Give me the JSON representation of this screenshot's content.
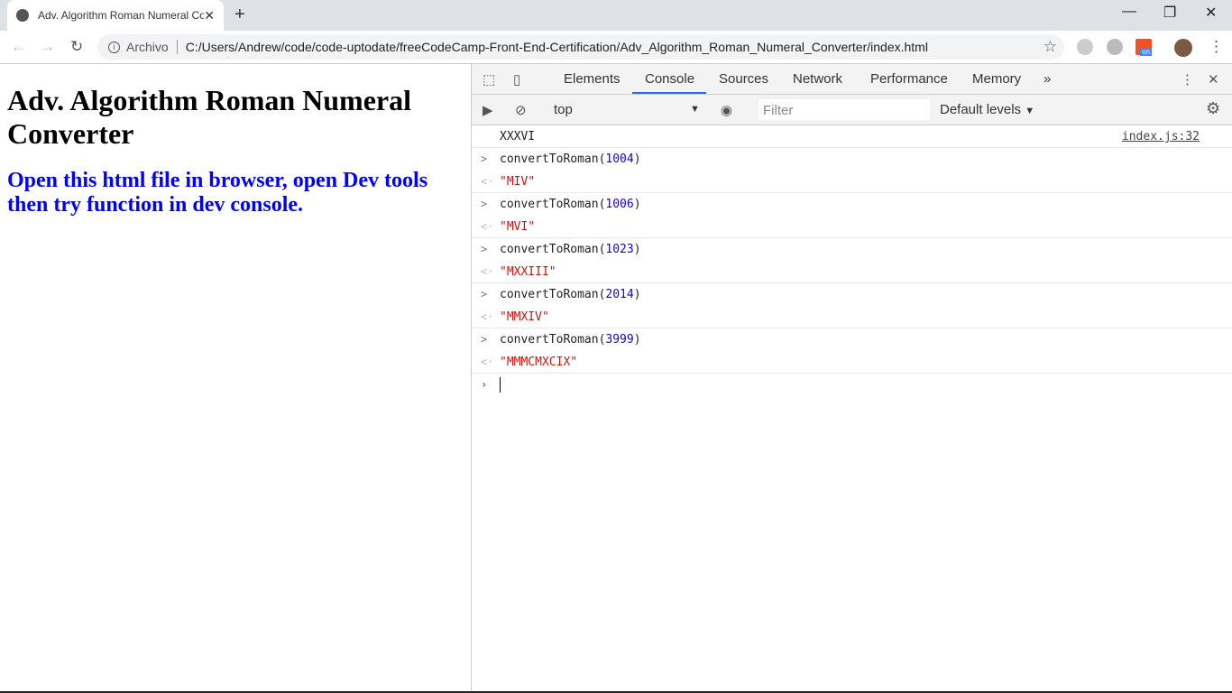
{
  "browser": {
    "tab_title": "Adv. Algorithm Roman Numeral Converter",
    "scheme_label": "Archivo",
    "url": "C:/Users/Andrew/code/code-uptodate/freeCodeCamp-Front-End-Certification/Adv_Algorithm_Roman_Numeral_Converter/index.html",
    "ext_badge": "on"
  },
  "page": {
    "title": "Adv. Algorithm Roman Numeral Converter",
    "subtitle": "Open this html file in browser, open Dev tools then try function in dev console."
  },
  "devtools": {
    "tabs": [
      "Elements",
      "Console",
      "Sources",
      "Network",
      "Performance",
      "Memory"
    ],
    "active_tab": "Console",
    "context": "top",
    "filter_placeholder": "Filter",
    "levels": "Default levels"
  },
  "console": {
    "log": {
      "text": "XXXVI",
      "source": "index.js:32"
    },
    "entries": [
      {
        "fn": "convertToRoman(",
        "arg": "1004",
        "close": ")",
        "result": "\"MIV\""
      },
      {
        "fn": "convertToRoman(",
        "arg": "1006",
        "close": ")",
        "result": "\"MVI\""
      },
      {
        "fn": "convertToRoman(",
        "arg": "1023",
        "close": ")",
        "result": "\"MXXIII\""
      },
      {
        "fn": "convertToRoman(",
        "arg": "2014",
        "close": ")",
        "result": "\"MMXIV\""
      },
      {
        "fn": "convertToRoman(",
        "arg": "3999",
        "close": ")",
        "result": "\"MMMCMXCIX\""
      }
    ]
  }
}
